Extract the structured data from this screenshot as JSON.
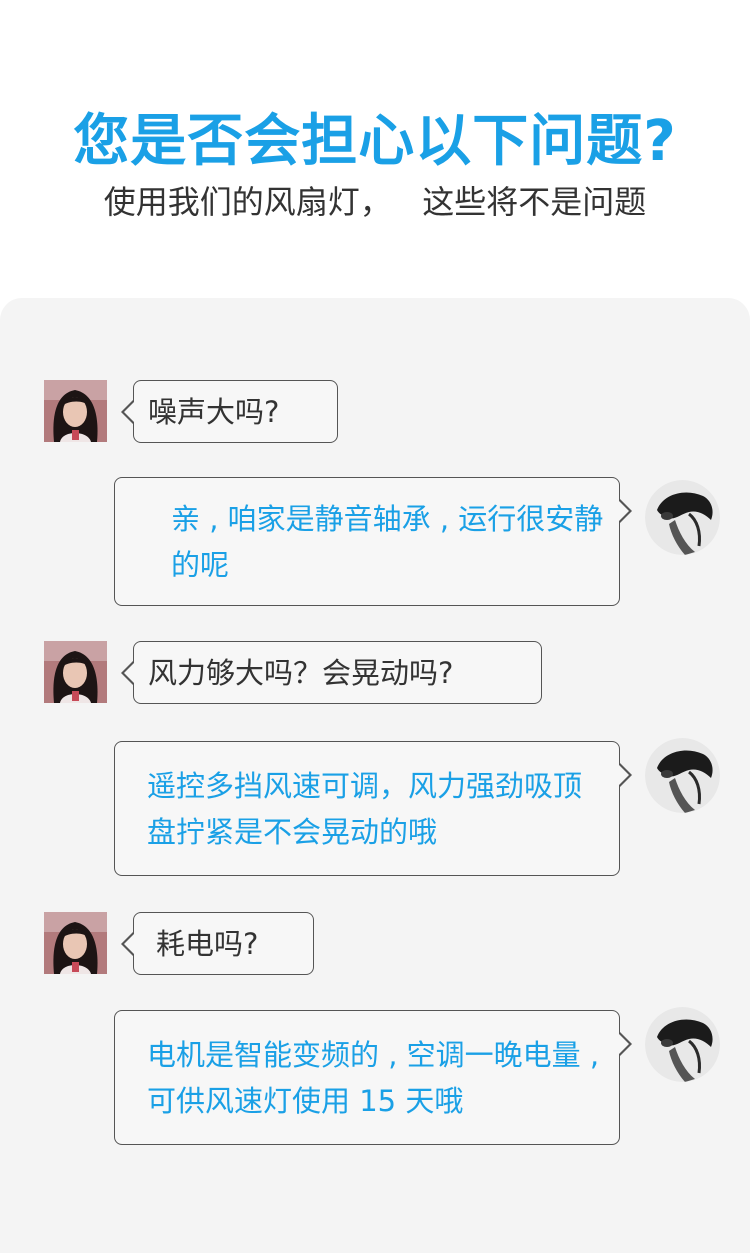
{
  "header": {
    "title": "您是否会担心以下问题?",
    "subtitle": "使用我们的风扇灯，   这些将不是问题"
  },
  "chat": [
    {
      "role": "customer",
      "avatar_icon": "girl-avatar",
      "text": "噪声大吗?"
    },
    {
      "role": "seller",
      "avatar_icon": "sketch-portrait-avatar",
      "text": "亲 , 咱家是静音轴承 , 运行很安静的呢"
    },
    {
      "role": "customer",
      "avatar_icon": "girl-avatar",
      "text": "风力够大吗？会晃动吗?"
    },
    {
      "role": "seller",
      "avatar_icon": "sketch-portrait-avatar",
      "text": "遥控多挡风速可调，风力强劲吸顶盘拧紧是不会晃动的哦"
    },
    {
      "role": "customer",
      "avatar_icon": "girl-avatar",
      "text": "耗电吗?"
    },
    {
      "role": "seller",
      "avatar_icon": "sketch-portrait-avatar",
      "text": "电机是智能变频的 , 空调一晚电量 , 可供风速灯使用 15 天哦"
    }
  ],
  "colors": {
    "accent": "#1aa0e6",
    "text_dark": "#333333",
    "panel_bg": "#f4f4f4",
    "bubble_border": "#555555"
  }
}
